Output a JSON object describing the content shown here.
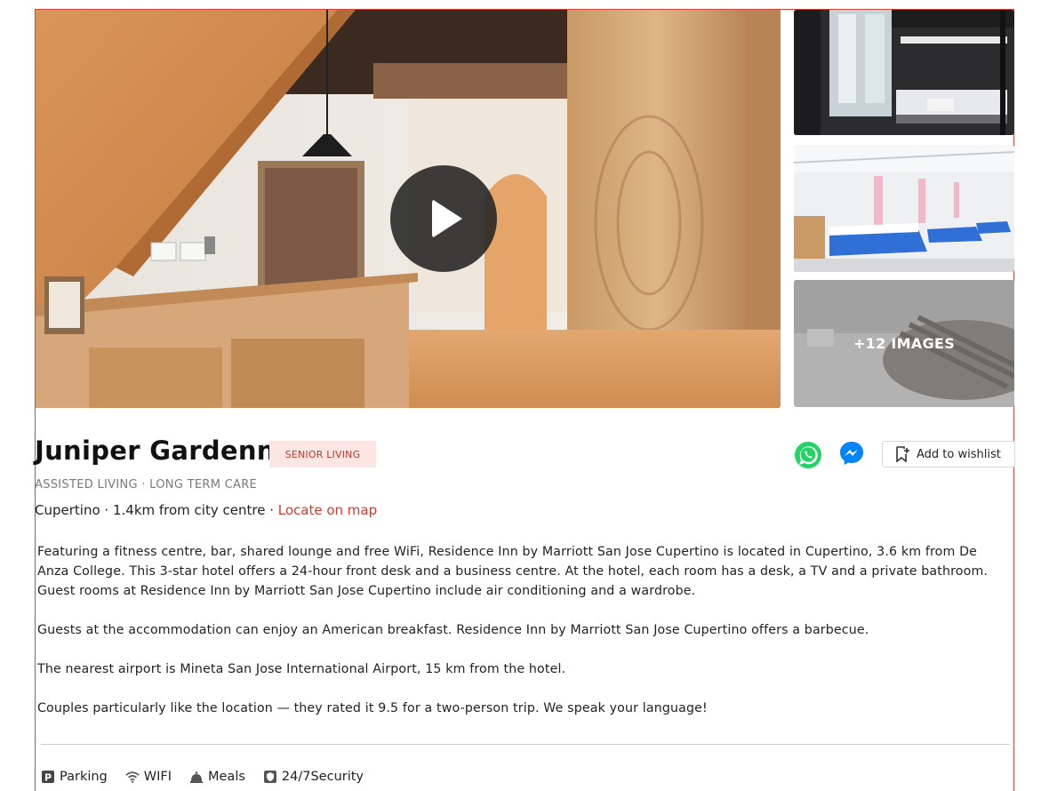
{
  "gallery": {
    "more_images_label": "+12 IMAGES"
  },
  "listing": {
    "title": "Juniper Gardenn",
    "badge": "SENIOR LIVING",
    "subcategories": "ASSISTED LIVING · LONG TERM CARE",
    "city": "Cupertino",
    "distance": "· 1.4km from city centre ·",
    "map_link": "Locate on map"
  },
  "actions": {
    "wishlist_label": "Add to wishlist"
  },
  "description": [
    "Featuring a fitness centre, bar, shared lounge and free WiFi, Residence Inn by Marriott San Jose Cupertino is located in Cupertino, 3.6 km from De Anza College. This 3-star hotel offers a 24-hour front desk and a business centre. At the hotel, each room has a desk, a TV and a private bathroom. Guest rooms at Residence Inn by Marriott San Jose Cupertino include air conditioning and a wardrobe.",
    "Guests at the accommodation can enjoy an American breakfast. Residence Inn by Marriott San Jose Cupertino offers a barbecue.",
    "The nearest airport is Mineta San Jose International Airport, 15 km from the hotel.",
    "Couples particularly like the location — they rated it 9.5 for a two-person trip. We speak your language!"
  ],
  "amenities": [
    {
      "icon": "parking-icon",
      "label": "Parking"
    },
    {
      "icon": "wifi-icon",
      "label": "WIFI"
    },
    {
      "icon": "meals-icon",
      "label": "Meals"
    },
    {
      "icon": "security-icon",
      "label": "24/7Security"
    }
  ],
  "colors": {
    "accent": "#d23b2a",
    "badge_bg": "#fbe6e4",
    "whatsapp": "#25d366",
    "messenger": "#0084ff"
  }
}
